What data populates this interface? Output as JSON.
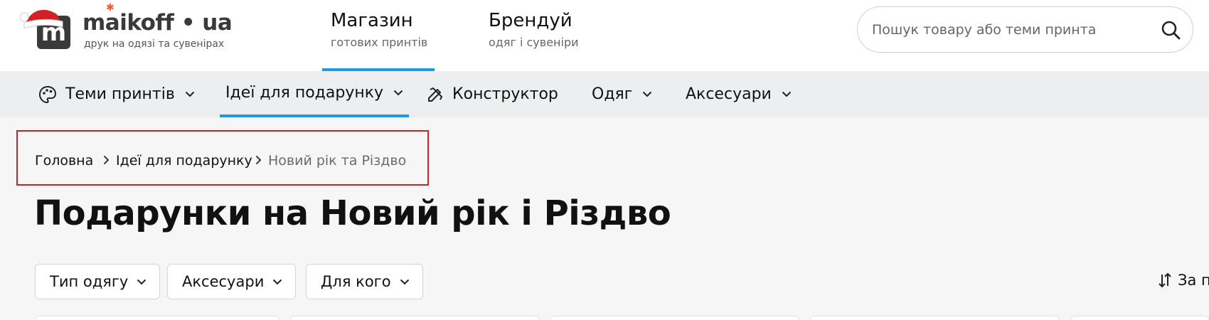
{
  "logo": {
    "name": "maikoff • ua",
    "tagline": "друк на одязі та сувенірах",
    "icon": "logo-m-santa-hat-icon"
  },
  "header_tabs": [
    {
      "title": "Магазин",
      "subtitle": "готових принтів",
      "active": true
    },
    {
      "title": "Брендуй",
      "subtitle": "одяг і сувеніри",
      "active": false
    }
  ],
  "search": {
    "placeholder": "Пошук товару або теми принта",
    "icon": "search-icon"
  },
  "nav": [
    {
      "label": "Теми принтів",
      "icon": "palette-icon",
      "dropdown": true,
      "active": false
    },
    {
      "label": "Ідеї для подарунку",
      "dropdown": true,
      "active": true
    },
    {
      "label": "Конструктор",
      "icon": "pencil-ruler-icon",
      "dropdown": false,
      "active": false
    },
    {
      "label": "Одяг",
      "dropdown": true,
      "active": false
    },
    {
      "label": "Аксесуари",
      "dropdown": true,
      "active": false
    }
  ],
  "breadcrumb": [
    {
      "label": "Головна"
    },
    {
      "label": "Ідеї для подарунку"
    },
    {
      "label": "Новий рік та Різдво"
    }
  ],
  "page_title": "Подарунки на Новий рік і Різдво",
  "filters": [
    {
      "label": "Тип одягу"
    },
    {
      "label": "Аксесуари"
    },
    {
      "label": "Для кого"
    }
  ],
  "sort": {
    "label": "За п",
    "icon": "sort-arrows-icon"
  },
  "colors": {
    "accent": "#1e9ae0",
    "highlight_border": "#d31f26",
    "logo_dark": "#3a3a3a",
    "logo_star": "#f15a24",
    "nav_bg": "#eceeef",
    "page_bg": "#f6f6f6"
  }
}
